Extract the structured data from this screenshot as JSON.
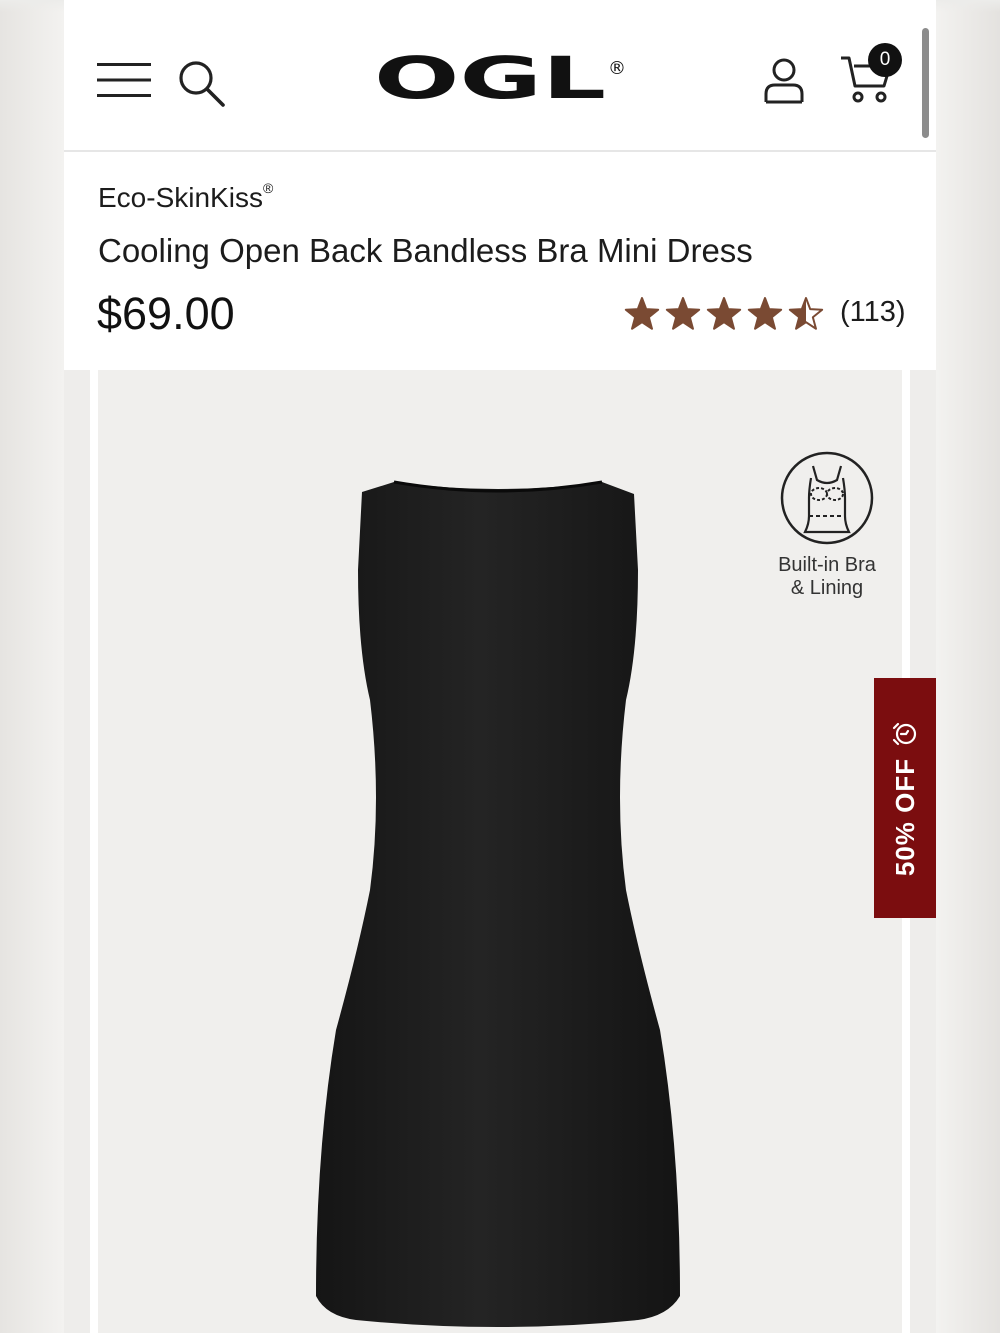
{
  "header": {
    "logo_text": "OGL",
    "logo_mark": "®",
    "cart_count": "0",
    "icons": {
      "menu": "hamburger-menu-icon",
      "search": "search-icon",
      "account": "user-icon",
      "cart": "shopping-cart-icon"
    }
  },
  "product": {
    "brand": "Eco-SkinKiss",
    "brand_mark": "®",
    "title": "Cooling Open Back Bandless Bra Mini Dress",
    "price": "$69.00",
    "rating": 4.5,
    "review_count": "(113)",
    "star_color": "#7a4a33"
  },
  "gallery": {
    "feature_label_line1": "Built-in Bra",
    "feature_label_line2": "& Lining",
    "feature_icon": "built-in-bra-icon",
    "dress_color": "#1c1c1c"
  },
  "promo": {
    "text": "50% OFF",
    "icon": "alarm-clock-icon",
    "color": "#7b0d0f"
  }
}
